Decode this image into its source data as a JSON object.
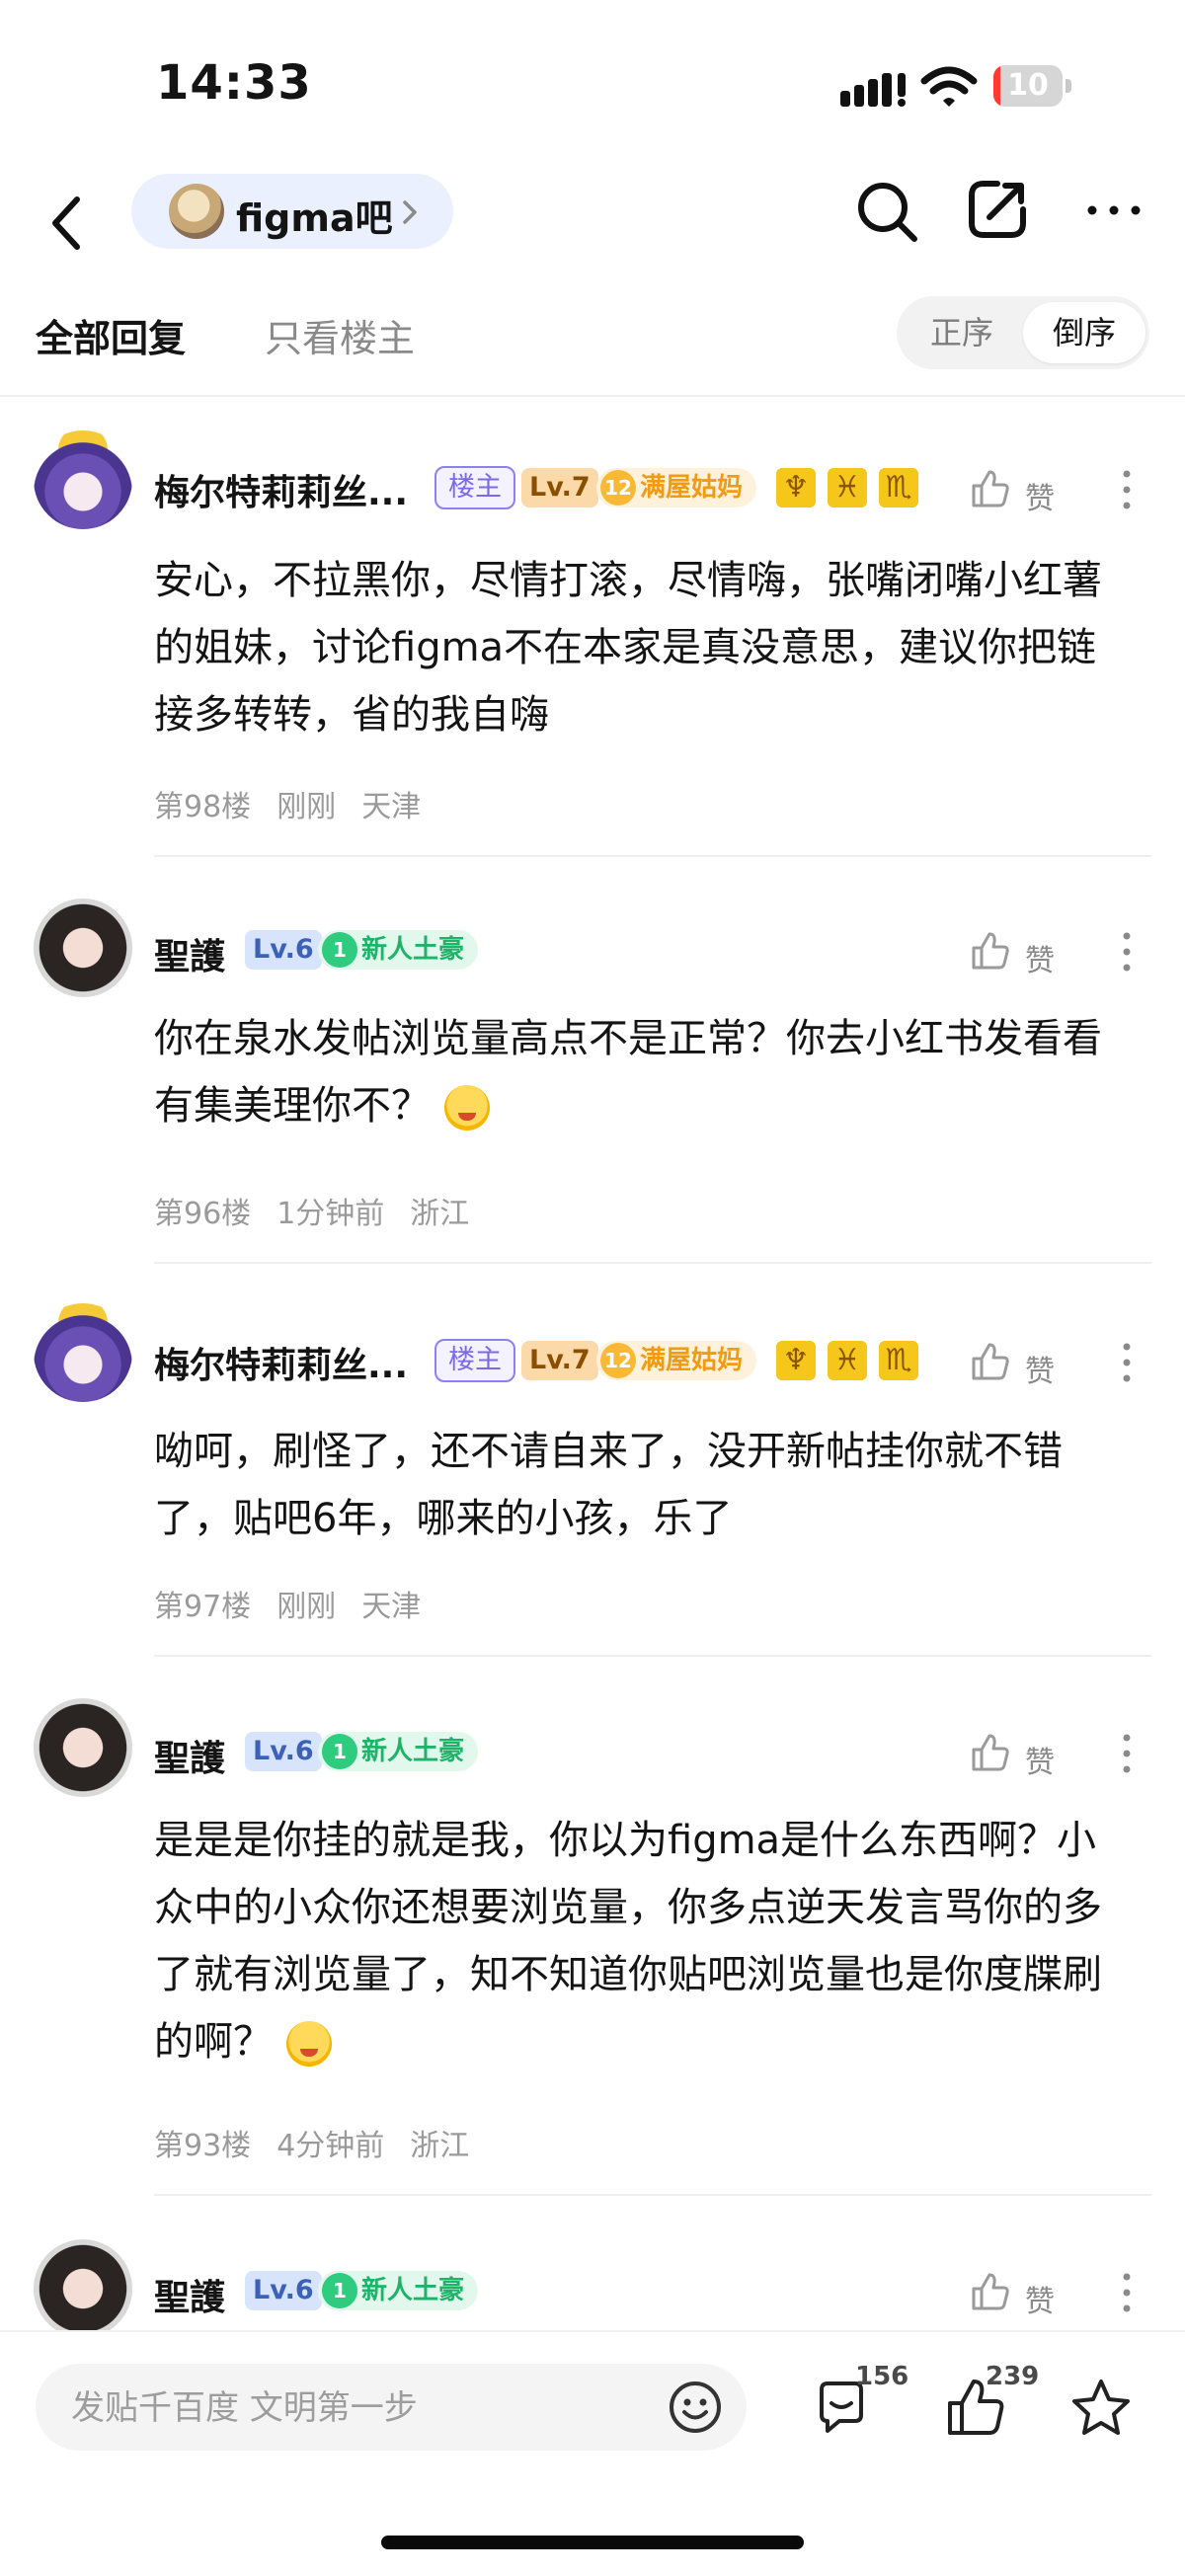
{
  "status_bar": {
    "time": "14:33",
    "battery_level": "10",
    "battery_fraction": 0.1
  },
  "nav": {
    "forum_name": "figma吧"
  },
  "tabs": {
    "all_replies": "全部回复",
    "only_host": "只看楼主"
  },
  "sort": {
    "asc": "正序",
    "desc": "倒序",
    "selected": "倒序"
  },
  "posts": [
    {
      "username": "梅尔特莉莉丝...",
      "host_badge": "楼主",
      "level": "Lv.7",
      "tag_num": "12",
      "tag": "满屋姑妈",
      "zodiac": [
        "♆",
        "♓",
        "♏"
      ],
      "like_label": "赞",
      "content": "安心，不拉黑你，尽情打滚，尽情嗨，张嘴闭嘴小红薯的姐妹，讨论figma不在本家是真没意思，建议你把链接多转转，省的我自嗨",
      "floor": "第98楼",
      "time": "刚刚",
      "location": "天津"
    },
    {
      "username": "聖護",
      "level": "Lv.6",
      "tag_num": "1",
      "tag": "新人土豪",
      "like_label": "赞",
      "content": "你在泉水发帖浏览量高点不是正常？你去小红书发看看有集美理你不？",
      "floor": "第96楼",
      "time": "1分钟前",
      "location": "浙江"
    },
    {
      "username": "梅尔特莉莉丝...",
      "host_badge": "楼主",
      "level": "Lv.7",
      "tag_num": "12",
      "tag": "满屋姑妈",
      "zodiac": [
        "♆",
        "♓",
        "♏"
      ],
      "like_label": "赞",
      "content": "呦呵，刷怪了，还不请自来了，没开新帖挂你就不错了，贴吧6年，哪来的小孩，乐了",
      "floor": "第97楼",
      "time": "刚刚",
      "location": "天津"
    },
    {
      "username": "聖護",
      "level": "Lv.6",
      "tag_num": "1",
      "tag": "新人土豪",
      "like_label": "赞",
      "content": "是是是你挂的就是我，你以为figma是什么东西啊？小众中的小众你还想要浏览量，你多点逆天发言骂你的多了就有浏览量了，知不知道你贴吧浏览量也是你度牒刷的啊？",
      "floor": "第93楼",
      "time": "4分钟前",
      "location": "浙江"
    },
    {
      "username": "聖護",
      "level": "Lv.6",
      "tag_num": "1",
      "tag": "新人土豪",
      "like_label": "赞"
    }
  ],
  "bottom_bar": {
    "input_placeholder": "发贴千百度 文明第一步",
    "comment_count": "156",
    "like_count": "239"
  }
}
